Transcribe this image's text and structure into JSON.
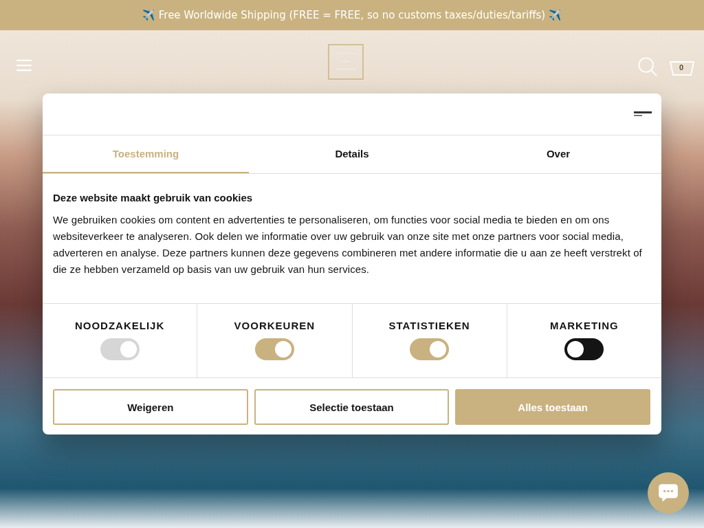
{
  "announcement": {
    "text": "✈️ Free Worldwide Shipping (FREE = FREE, so no customs taxes/duties/tariffs) ✈️"
  },
  "header": {
    "cart_count": "0"
  },
  "consent": {
    "tabs": [
      {
        "label": "Toestemming",
        "selected": true
      },
      {
        "label": "Details",
        "selected": false
      },
      {
        "label": "Over",
        "selected": false
      }
    ],
    "heading": "Deze website maakt gebruik van cookies",
    "body": "We gebruiken cookies om content en advertenties te personaliseren, om functies voor social media te bieden en om ons websiteverkeer te analyseren. Ook delen we informatie over uw gebruik van onze site met onze partners voor social media, adverteren en analyse. Deze partners kunnen deze gegevens combineren met andere informatie die u aan ze heeft verstrekt of die ze hebben verzameld op basis van uw gebruik van hun services.",
    "categories": [
      {
        "label": "NOODZAKELIJK",
        "checked": true,
        "disabled": true
      },
      {
        "label": "VOORKEUREN",
        "checked": true,
        "disabled": false
      },
      {
        "label": "STATISTIEKEN",
        "checked": true,
        "disabled": false
      },
      {
        "label": "MARKETING",
        "checked": false,
        "disabled": false
      }
    ],
    "buttons": [
      {
        "label": "Weigeren",
        "kind": "outline"
      },
      {
        "label": "Selectie toestaan",
        "kind": "outline"
      },
      {
        "label": "Alles toestaan",
        "kind": "filled"
      }
    ]
  }
}
